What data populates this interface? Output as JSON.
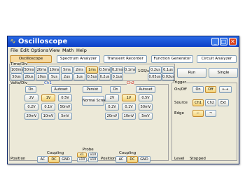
{
  "window": {
    "title": "Oscilloscope",
    "minimize": "_",
    "maximize": "□",
    "close": "✕",
    "app_icon": "oscilloscope-icon"
  },
  "menu": [
    "File",
    "Edit",
    "Options",
    "View",
    "Math",
    "Help"
  ],
  "tabs": [
    "Oscilloscope",
    "Spectrum Analyzer",
    "Transient Recorder",
    "Function Generator",
    "Circuit Analyzer"
  ],
  "active_tab": 0,
  "timebase": {
    "label": "Time/Div",
    "row1": [
      "100ms",
      "50ms",
      "20ms",
      "10ms",
      "5ms",
      "2ms",
      "1ms",
      "0.5ms",
      "0.2ms",
      "0.1ms"
    ],
    "row2": [
      "50us",
      "20us",
      "10us",
      "5us",
      "2us",
      "1us",
      "0.5us",
      "0.2us",
      "0.1us"
    ],
    "selected": "1ms",
    "sample_rate": "1GS/s",
    "ext_row1": [
      "0.2us",
      "0.1us"
    ],
    "ext_row2": [
      "0.05us",
      "0.02us"
    ]
  },
  "run_label": "Run",
  "single_label": "Single",
  "volts_label": "Volts/Div",
  "ch1": {
    "name": "Ch1",
    "on": "On",
    "autoset": "Autoset",
    "volts": [
      [
        "2V",
        "1V",
        "0.5V"
      ],
      [
        "0.2V",
        "0.1V",
        "50mV"
      ],
      [
        "20mV",
        "10mV",
        "5mV"
      ]
    ],
    "selected": "1V"
  },
  "ch2": {
    "name": "Ch2",
    "on": "On",
    "autoset": "Autoset",
    "volts": [
      [
        "2V",
        "1V",
        "0.5V"
      ],
      [
        "0.2V",
        "0.1V",
        "50mV"
      ],
      [
        "20mV",
        "10mV",
        "5mV"
      ]
    ],
    "selected": "1V"
  },
  "persist_label": "Persist",
  "normal_screen_label": "Normal Screen",
  "probe": {
    "label": "Probe",
    "options": [
      "x1",
      "x10"
    ],
    "selected": "x1"
  },
  "coupling": {
    "label": "Coupling",
    "options": [
      "AC",
      "DC",
      "GND"
    ],
    "selected": "DC"
  },
  "position_label": "Position",
  "trigger": {
    "label": "Trigger",
    "onoff_label": "On/Off",
    "on": "On",
    "off": "Off",
    "selected_onoff": "Off",
    "source_label": "Source",
    "sources": [
      "Ch1",
      "Ch2",
      "Ext"
    ],
    "selected_source": "Ch1",
    "edge_label": "Edge",
    "level_label": "Level",
    "status": "Stopped"
  },
  "colors": {
    "accent": "#f4d27a",
    "titlebar": "#0c3fc7",
    "ch1": "#2050d0",
    "ch2": "#d02020"
  }
}
